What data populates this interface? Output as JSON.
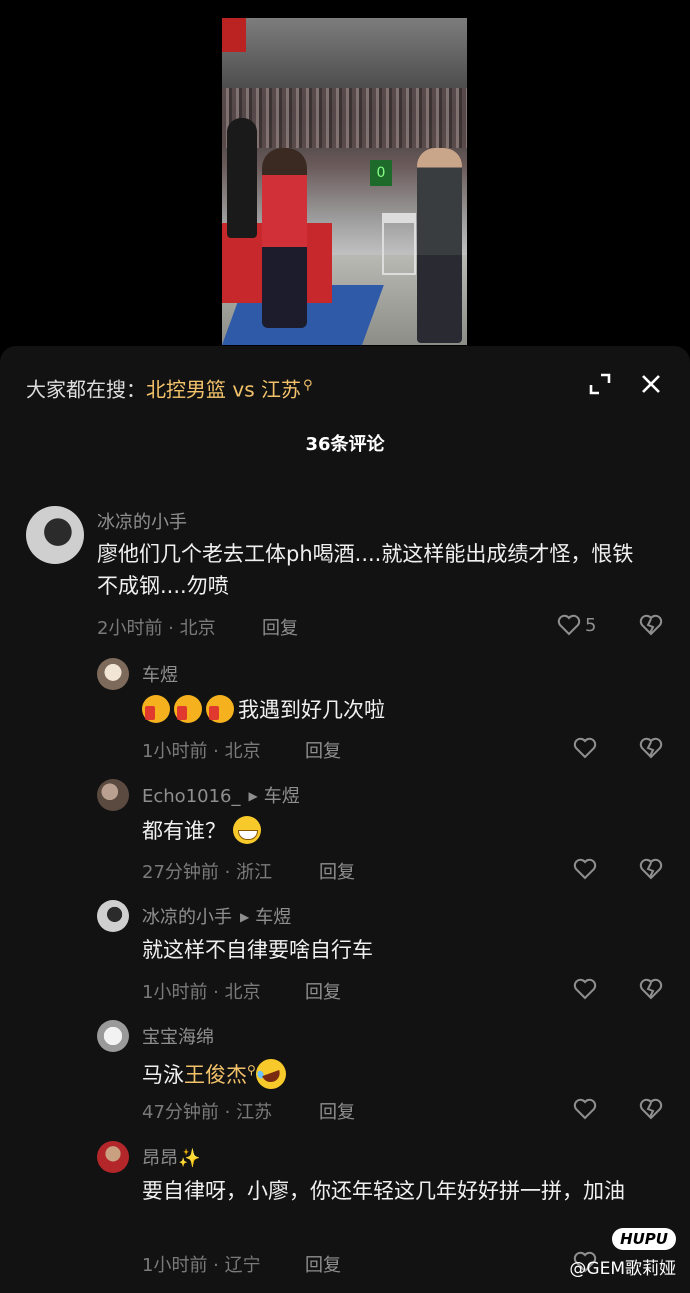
{
  "search": {
    "prefix": "大家都在搜：",
    "keyword": "北控男篮 vs 江苏",
    "icon": "search-icon"
  },
  "comment_count_title": "36条评论",
  "reply_label": "回复",
  "comments": [
    {
      "user": "冰凉的小手",
      "text": "廖他们几个老去工体ph喝酒....就这样能出成绩才怪，恨铁不成钢....勿喷",
      "meta": "2小时前 · 北京",
      "likes": "5"
    },
    {
      "user": "车煜",
      "text": "我遇到好几次啦",
      "emoji": "thumbs-up x3",
      "meta": "1小时前 · 北京"
    },
    {
      "user": "Echo1016_",
      "reply_to": "车煜",
      "text": "都有谁？",
      "emoji": "grinning-face",
      "meta": "27分钟前 · 浙江"
    },
    {
      "user": "冰凉的小手",
      "reply_to": "车煜",
      "text": "就这样不自律要啥自行车",
      "meta": "1小时前 · 北京"
    },
    {
      "user": "宝宝海绵",
      "text_prefix": "马泳",
      "keyword": "王俊杰",
      "emoji": "rolling-laughing-face",
      "meta": "47分钟前 · 江苏"
    },
    {
      "user": "昂昂",
      "user_emoji": "✨",
      "text": "要自律呀，小廖，你还年轻这几年好好拼一拼，加油",
      "meta": "1小时前 · 辽宁"
    }
  ],
  "watermark": {
    "logo": "HUPU",
    "credit": "@GEM歌莉娅"
  },
  "colors": {
    "background": "#000000",
    "sheet": "#121212",
    "keyword": "#f3c36b",
    "muted": "#8f8f8f"
  }
}
